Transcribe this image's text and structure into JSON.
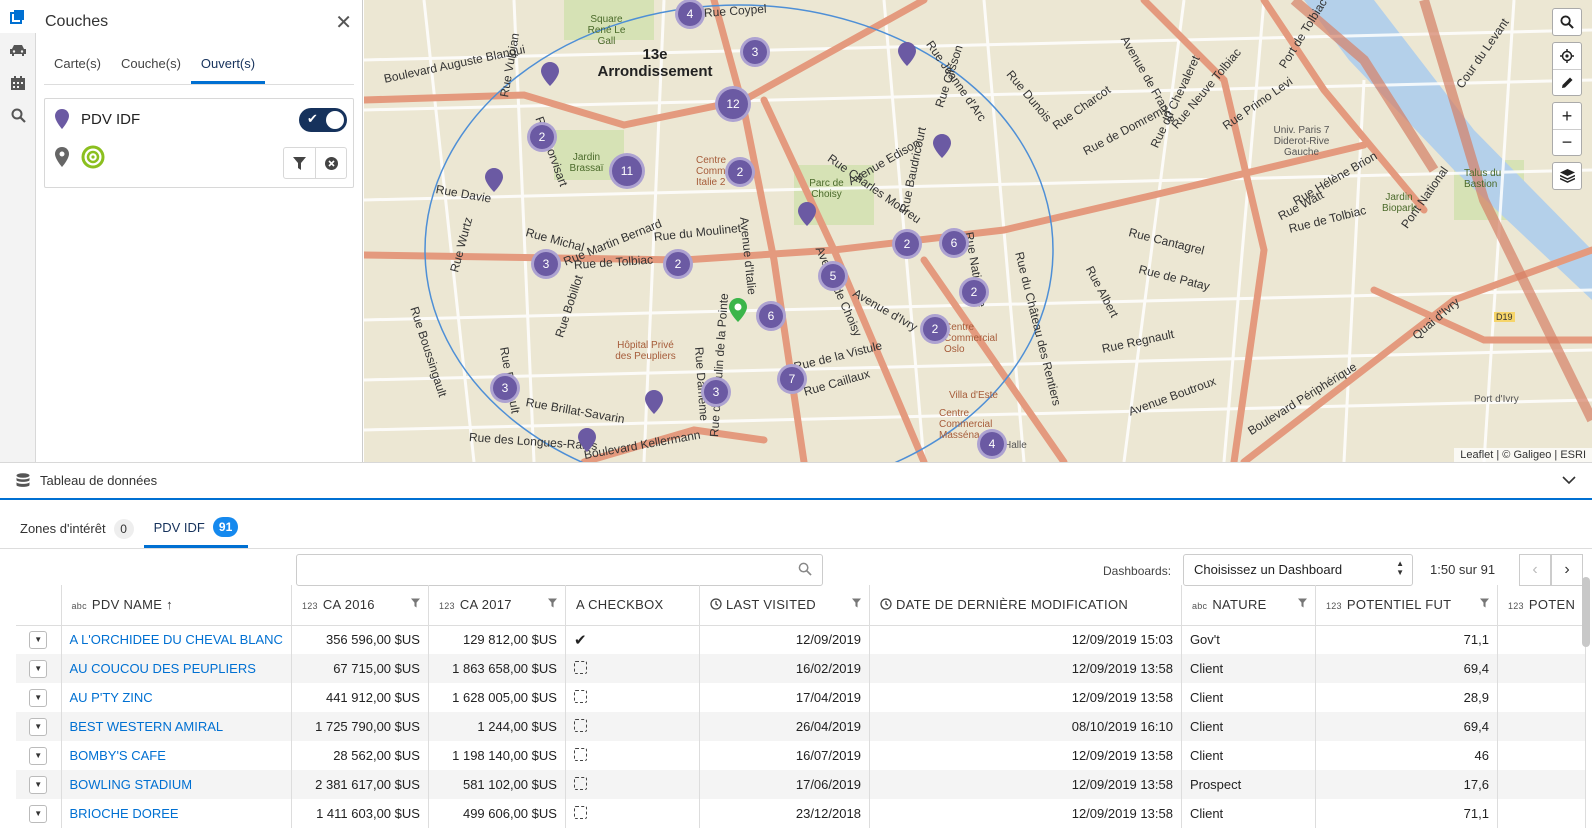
{
  "panel": {
    "title": "Couches",
    "tabs": [
      "Carte(s)",
      "Couche(s)",
      "Ouvert(s)"
    ],
    "active_tab": 2,
    "layer": {
      "name": "PDV IDF",
      "enabled": true
    }
  },
  "map": {
    "district": "13e\nArrondissement",
    "attribution": "Leaflet | © Galigeo | ESRI",
    "streets": [
      "Boulevard Auguste Blanqui",
      "Rue de Tolbiac",
      "Rue Michal",
      "Rue Martin Bernard",
      "Rue du Moulinet",
      "Avenue d'Italie",
      "Avenue de Choisy",
      "Avenue d'Ivry",
      "Rue Nationale",
      "Rue Brillat-Savarin",
      "Boulevard Kellermann",
      "Rue des Longues-Raies",
      "Rue de la Glacière",
      "Rue Vulpian",
      "Rue Corvisart",
      "Rue Coypel",
      "Rue Jeanne d'Arc",
      "Rue Charcot",
      "Rue de Domremy",
      "Rue du Chevaleret",
      "Rue Primo Levi",
      "Avenue de France",
      "Rue Neuve Tolbiac",
      "Port de Tolbiac",
      "Rue Hélène Brion",
      "Rue Watt",
      "Rue Cantagrel",
      "Rue de Patay",
      "Rue Albert",
      "Rue Regnault",
      "Avenue Boutroux",
      "Boulevard Périphérique",
      "Quai d'Ivry",
      "Pont National",
      "Rue Davie",
      "Rue Wurtz",
      "Rue Boussingault",
      "Rue Bobillot",
      "Rue Barrault",
      "Rue Dameme",
      "Rue du Moulin de la Pointe",
      "Rue Caillaux",
      "Rue de la Vistule",
      "Avenue Edison",
      "Rue Charles Moureu",
      "Rue du Château des Rentiers",
      "Rue Baudricourt",
      "Rue de Rungis",
      "Rue Clisson",
      "Rue Dunois",
      "Cour du Levant"
    ],
    "places": [
      "Jardin Brassaï",
      "Parc de Choisy",
      "Square René Le Gall",
      "Centre Commercial Italie 2",
      "Hôpital Privé des Peupliers",
      "Centre Commercial Oslo",
      "Villa d'Este",
      "Centre Commercial Masséna",
      "Univ. Paris 7 Diderot-Rive Gauche",
      "Jardin Biopark",
      "Talus du Bastion",
      "Port d'Ivry",
      "D19",
      "Halle"
    ],
    "clusters": [
      "4",
      "3",
      "12",
      "2",
      "11",
      "2",
      "3",
      "2",
      "5",
      "2",
      "6",
      "2",
      "6",
      "2",
      "3",
      "3",
      "7",
      "4"
    ]
  },
  "data_panel": {
    "title": "Tableau de données",
    "tabs": [
      {
        "label": "Zones d'intérêt",
        "count": "0"
      },
      {
        "label": "PDV IDF",
        "count": "91"
      }
    ],
    "search_placeholder": "",
    "dashboards_label": "Dashboards:",
    "dashboards_value": "Choisissez un Dashboard",
    "pager_text": "1:50 sur 91"
  },
  "table": {
    "columns": [
      {
        "type": "",
        "label": ""
      },
      {
        "type": "abc",
        "label": "PDV NAME ↑"
      },
      {
        "type": "123",
        "label": "CA 2016"
      },
      {
        "type": "123",
        "label": "CA 2017"
      },
      {
        "type": "",
        "label": "A CHECKBOX"
      },
      {
        "type": "clock",
        "label": "LAST VISITED"
      },
      {
        "type": "clock",
        "label": "DATE DE DERNIÈRE MODIFICATION"
      },
      {
        "type": "abc",
        "label": "NATURE"
      },
      {
        "type": "123",
        "label": "POTENTIEL FUT"
      },
      {
        "type": "123",
        "label": "POTEN"
      }
    ],
    "rows": [
      {
        "name": "A L'ORCHIDEE DU CHEVAL BLANC",
        "ca2016": "356 596,00 $US",
        "ca2017": "129 812,00 $US",
        "checked": true,
        "last": "12/09/2019",
        "mod": "12/09/2019 15:03",
        "nature": "Gov't",
        "pot": "71,1"
      },
      {
        "name": "AU COUCOU DES PEUPLIERS",
        "ca2016": "67 715,00 $US",
        "ca2017": "1 863 658,00 $US",
        "checked": false,
        "last": "16/02/2019",
        "mod": "12/09/2019 13:58",
        "nature": "Client",
        "pot": "69,4"
      },
      {
        "name": "AU P'TY ZINC",
        "ca2016": "441 912,00 $US",
        "ca2017": "1 628 005,00 $US",
        "checked": false,
        "last": "17/04/2019",
        "mod": "12/09/2019 13:58",
        "nature": "Client",
        "pot": "28,9"
      },
      {
        "name": "BEST WESTERN AMIRAL",
        "ca2016": "1 725 790,00 $US",
        "ca2017": "1 244,00 $US",
        "checked": false,
        "last": "26/04/2019",
        "mod": "08/10/2019 16:10",
        "nature": "Client",
        "pot": "69,4"
      },
      {
        "name": "BOMBY'S CAFE",
        "ca2016": "28 562,00 $US",
        "ca2017": "1 198 140,00 $US",
        "checked": false,
        "last": "16/07/2019",
        "mod": "12/09/2019 13:58",
        "nature": "Client",
        "pot": "46"
      },
      {
        "name": "BOWLING STADIUM",
        "ca2016": "2 381 617,00 $US",
        "ca2017": "581 102,00 $US",
        "checked": false,
        "last": "17/06/2019",
        "mod": "12/09/2019 13:58",
        "nature": "Prospect",
        "pot": "17,6"
      },
      {
        "name": "BRIOCHE DOREE",
        "ca2016": "1 411 603,00 $US",
        "ca2017": "499 606,00 $US",
        "checked": false,
        "last": "23/12/2018",
        "mod": "12/09/2019 13:58",
        "nature": "Client",
        "pot": "71,1"
      }
    ]
  },
  "colors": {
    "accent": "#0070d2",
    "navy": "#16325c",
    "cluster": "#6b5aa3",
    "pin_green": "#3bb54a"
  },
  "icons": [
    "layers-icon",
    "car-icon",
    "calendar-icon",
    "search-icon",
    "close-icon",
    "pin-icon",
    "target-icon",
    "filter-icon",
    "clear-icon",
    "locate-icon",
    "pencil-icon",
    "zoom-in-icon",
    "zoom-out-icon",
    "stack-icon",
    "chevron-down-icon",
    "chevron-left-icon",
    "chevron-right-icon",
    "clock-icon",
    "check-icon"
  ]
}
